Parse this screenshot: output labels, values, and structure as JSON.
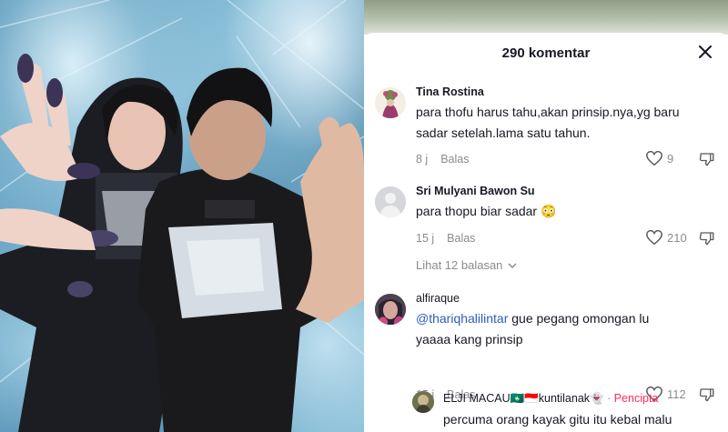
{
  "header": {
    "title": "290 komentar"
  },
  "comments": [
    {
      "username": "Tina Rostina",
      "line1": "para thofu harus tahu,akan prinsip.nya,yg baru",
      "line2": "sadar setelah.lama satu tahun.",
      "time": "8 j",
      "reply_label": "Balas",
      "likes": "9"
    },
    {
      "username": "Sri Mulyani Bawon Su",
      "line1": "para thopu biar sadar 😳",
      "time": "15 j",
      "reply_label": "Balas",
      "likes": "210",
      "view_replies": "Lihat 12 balasan"
    },
    {
      "username": "alfiraque",
      "mention": "@thariqhalilintar",
      "line1_rest": " gue pegang omongan lu",
      "line2": "yaaaa kang prinsip",
      "time": "15 j",
      "reply_label": "Balas",
      "likes": "112"
    }
  ],
  "reply": {
    "username": "ELJI MACAU🇲🇴🇮🇩kuntilanak👻",
    "separator": " · ",
    "creator_label": "Pencipta",
    "line1": "percuma orang kayak gitu itu kebal malu"
  },
  "icons": {
    "close": "close-icon",
    "like": "heart-icon",
    "dislike": "dislike-icon",
    "expand": "chevron-down-icon"
  },
  "colors": {
    "text": "#161823",
    "muted": "#8a8b91",
    "mention": "#2b5db8",
    "creator": "#fe2c55"
  }
}
